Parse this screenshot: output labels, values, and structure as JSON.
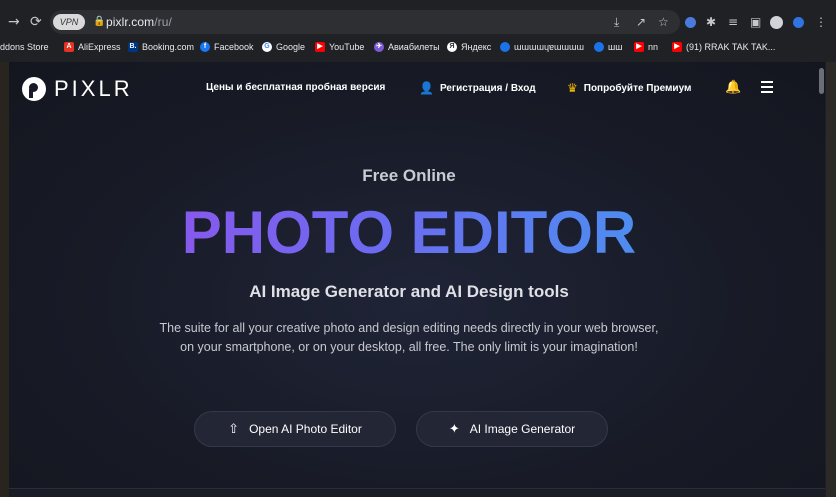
{
  "browser": {
    "vpn_label": "VPN",
    "url_host": "pixlr.com",
    "url_path": "/ru/",
    "bookmarks": [
      {
        "label": "ddons Store",
        "icon": "addons-icon",
        "color": "#4a4a4a"
      },
      {
        "label": "AliExpress",
        "icon": "aliexpress-icon",
        "color": "#e43225"
      },
      {
        "label": "Booking.com",
        "icon": "booking-icon",
        "color": "#003580"
      },
      {
        "label": "Facebook",
        "icon": "facebook-icon",
        "color": "#1877f2"
      },
      {
        "label": "Google",
        "icon": "google-icon",
        "color": "#ffffff"
      },
      {
        "label": "YouTube",
        "icon": "youtube-icon",
        "color": "#ff0000"
      },
      {
        "label": "Авиабилеты",
        "icon": "aviasales-icon",
        "color": "#7b5cd6"
      },
      {
        "label": "Яндекс",
        "icon": "yandex-icon",
        "color": "#ffffff"
      },
      {
        "label": "ɯɯɯɯɥɐɯɯɯɯ",
        "icon": "globe-icon",
        "color": "#1a73e8"
      },
      {
        "label": "шш",
        "icon": "globe-icon",
        "color": "#1a73e8"
      },
      {
        "label": "nn",
        "icon": "youtube-icon",
        "color": "#ff0000"
      },
      {
        "label": "(91) RRAK TAK TAK...",
        "icon": "youtube-icon",
        "color": "#ff0000"
      }
    ]
  },
  "header": {
    "logo_text": "PIXLR",
    "pricing_label": "Цены и бесплатная пробная версия",
    "login_label": "Регистрация / Вход",
    "premium_label": "Попробуйте Премиум"
  },
  "hero": {
    "eyebrow": "Free Online",
    "title": "PHOTO EDITOR",
    "subtitle": "AI Image Generator and AI Design tools",
    "description": "The suite for all your creative photo and design editing needs directly in your web browser, on your smartphone, or on your desktop, all free. The only limit is your imagination!",
    "btn_editor": "Open AI Photo Editor",
    "btn_generator": "AI Image Generator"
  },
  "colors": {
    "gradient_start": "#9f4ae8",
    "gradient_end": "#3aa3ef",
    "premium_crown": "#f6b800"
  }
}
